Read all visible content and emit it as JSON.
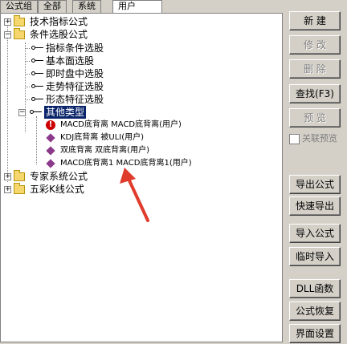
{
  "tabs": [
    {
      "label": "公式组"
    },
    {
      "label": "全部"
    },
    {
      "label": "系统"
    },
    {
      "label": "用户"
    }
  ],
  "tree": {
    "top_items": [
      {
        "label": "技术指标公式",
        "expander": "+"
      },
      {
        "label": "条件选股公式",
        "expander": "-"
      }
    ],
    "sub_items": [
      {
        "label": "指标条件选股"
      },
      {
        "label": "基本面选股"
      },
      {
        "label": "即时盘中选股"
      },
      {
        "label": "走势特征选股"
      },
      {
        "label": "形态特征选股"
      },
      {
        "label": "其他类型",
        "expander": "-"
      }
    ],
    "formulas": [
      {
        "label": "MACD底背离   MACD底背离(用户)",
        "icon": "alert-icon"
      },
      {
        "label": "KDJ底背离   被ULI(用户)",
        "icon": "diamond-icon"
      },
      {
        "label": "双底背离   双底背离(用户)",
        "icon": "diamond-icon"
      },
      {
        "label": "MACD底背离1   MACD底背离1(用户)",
        "icon": "diamond-icon"
      }
    ],
    "bottom_items": [
      {
        "label": "专家系统公式",
        "expander": "+"
      },
      {
        "label": "五彩K线公式",
        "expander": "+"
      }
    ]
  },
  "buttons": {
    "new": "新 建",
    "modify": "修 改",
    "delete": "删 除",
    "find": "查找(F3)",
    "preview": "预 览",
    "link_preview": "关联预览",
    "export": "导出公式",
    "quick_export": "快速导出",
    "import": "导入公式",
    "temp_import": "临时导入",
    "dll": "DLL函数",
    "restore": "公式恢复",
    "ui_settings": "界面设置"
  },
  "colors": {
    "panel_bg": "#d4d0c8",
    "selection": "#0a246a",
    "arrow": "#e03c2c"
  }
}
